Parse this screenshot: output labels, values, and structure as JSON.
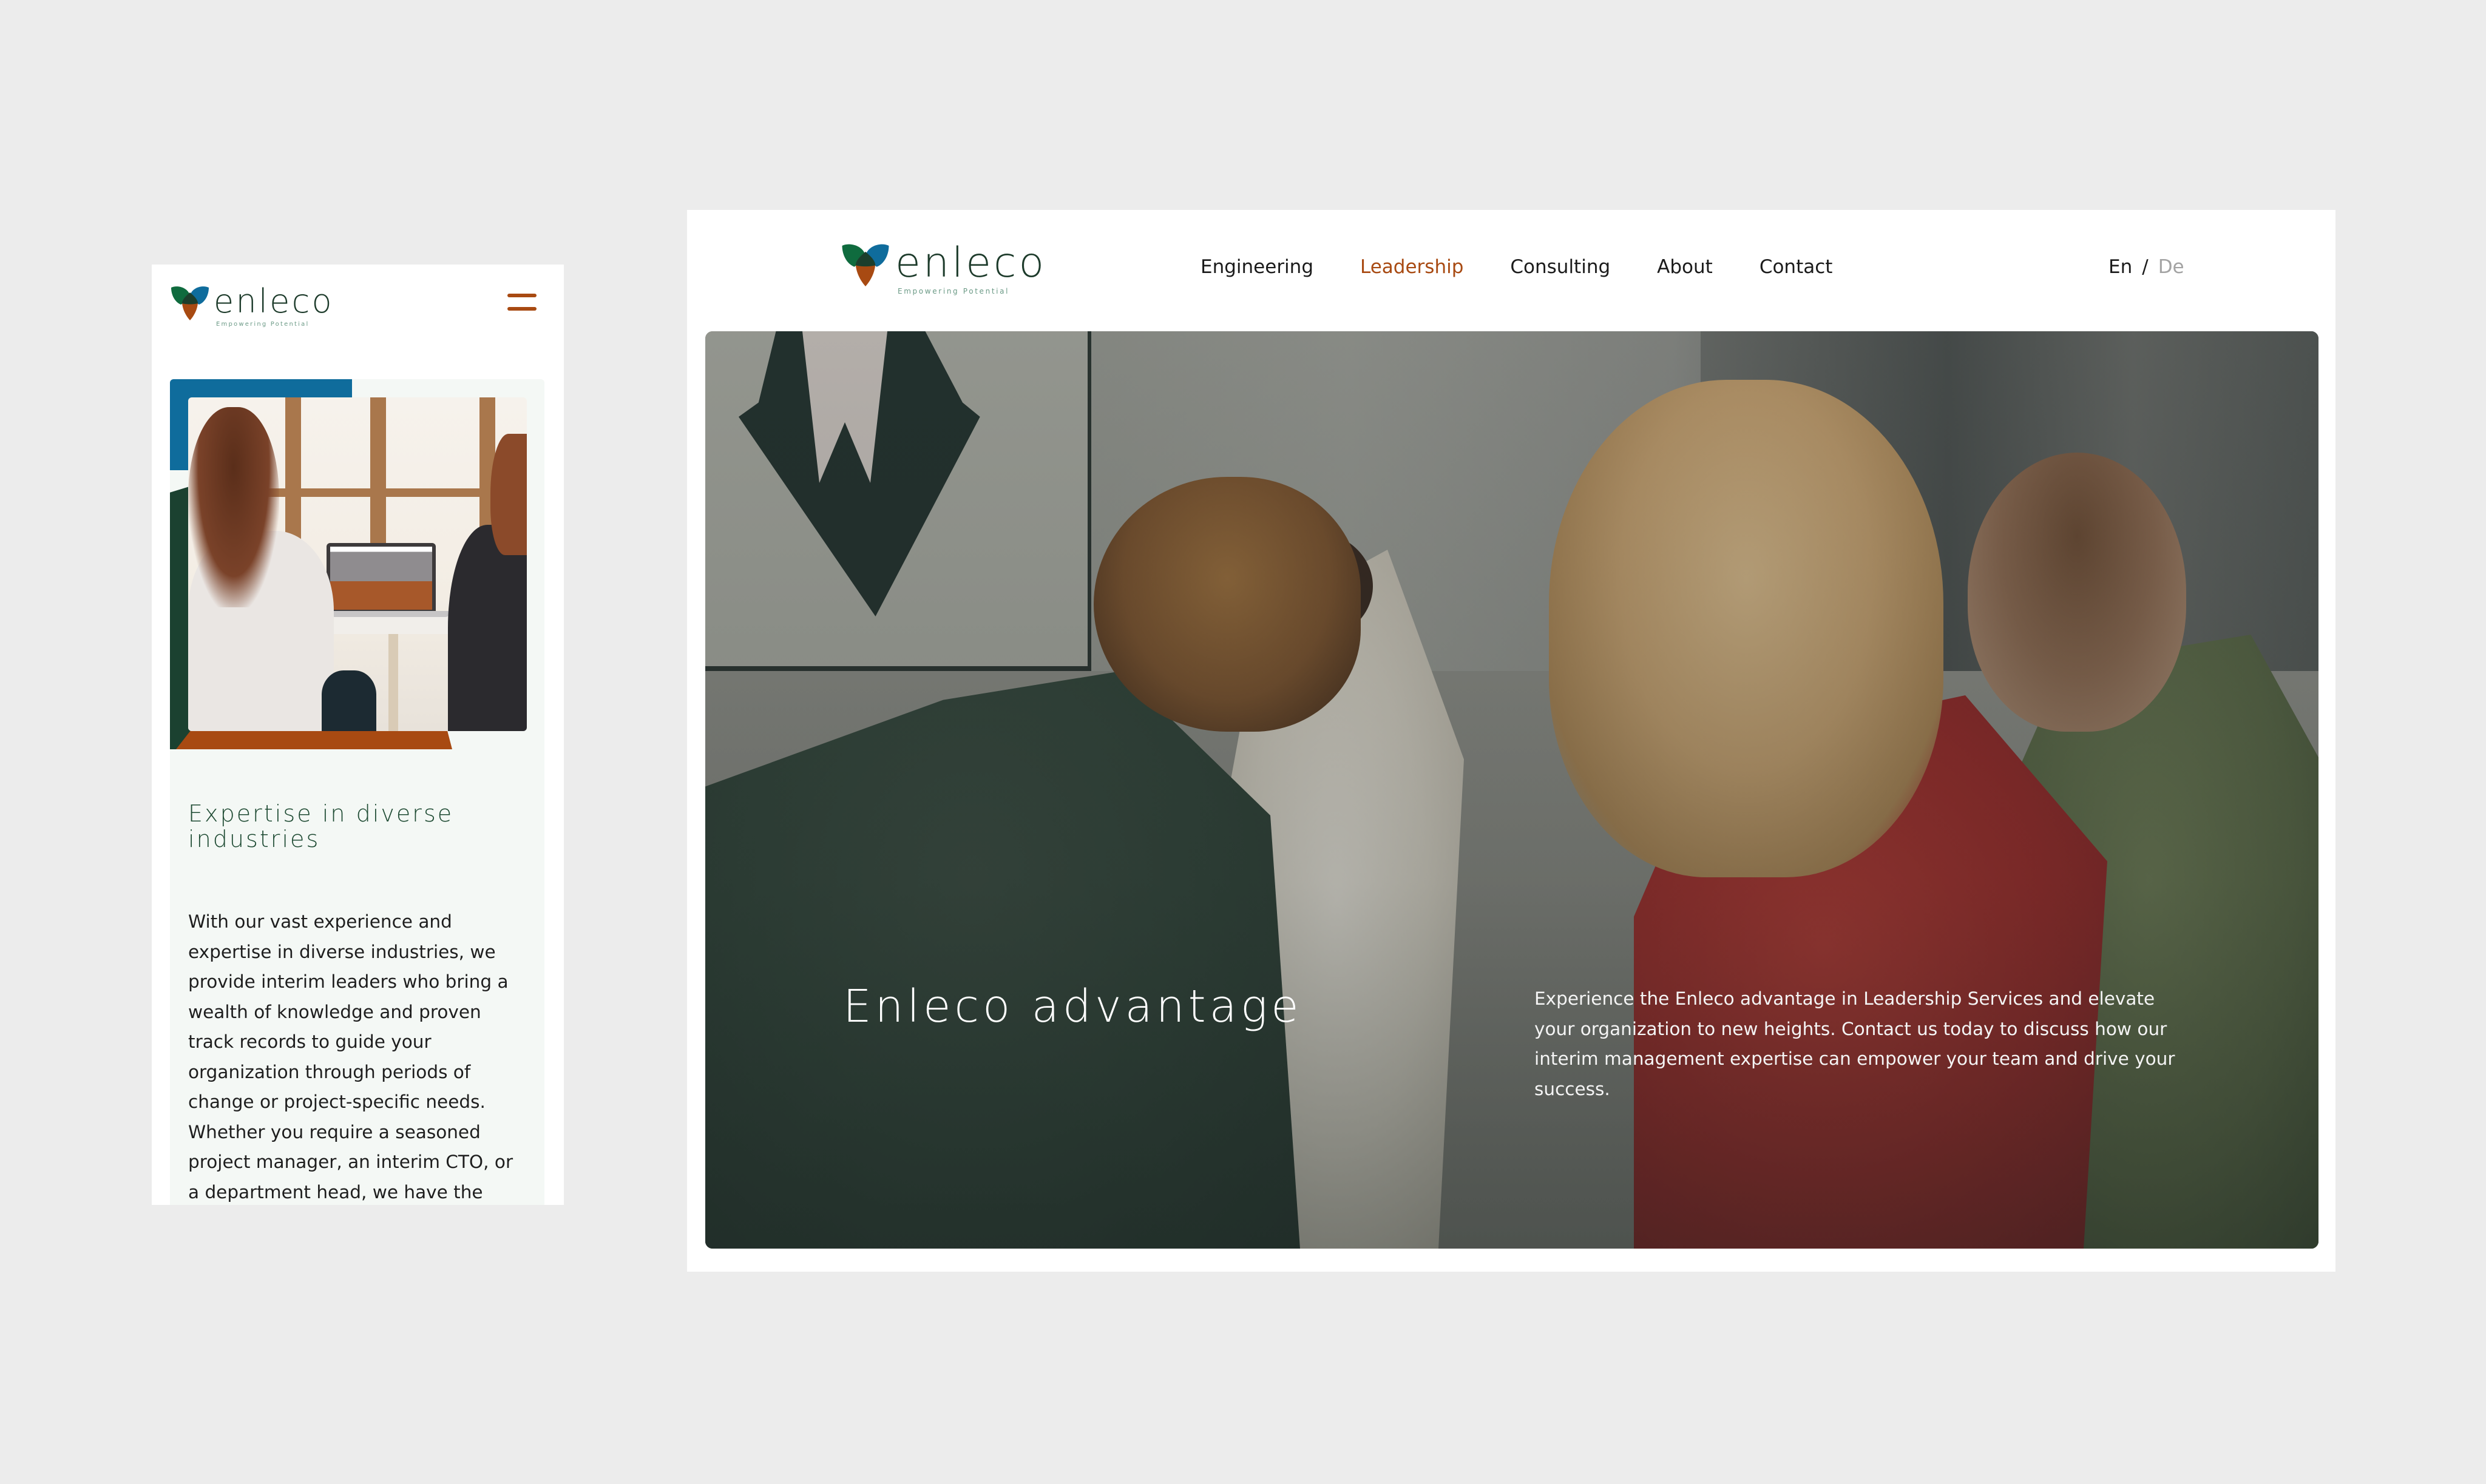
{
  "brand": {
    "name": "enleco",
    "tagline": "Empowering Potential",
    "colors": {
      "green": "#0f6b3e",
      "blue": "#0f6c9c",
      "orange": "#a84a12",
      "dark_green": "#1d3b2b",
      "card_bg": "#f4f8f5",
      "page_bg": "#ececec"
    }
  },
  "mobile": {
    "menu_icon": "hamburger-icon",
    "section": {
      "heading": "Expertise in diverse industries",
      "body": "With our vast experience and expertise in diverse industries, we provide interim leaders who bring a wealth of knowledge and proven track records to guide your organization through periods of change or project-specific needs. Whether you require a seasoned project manager, an interim CTO, or a department head, we have the",
      "image_alt": "Two women looking at a laptop showing the Enleco Leadership page"
    }
  },
  "desktop": {
    "nav": [
      {
        "label": "Engineering",
        "active": false
      },
      {
        "label": "Leadership",
        "active": true
      },
      {
        "label": "Consulting",
        "active": false
      },
      {
        "label": "About",
        "active": false
      },
      {
        "label": "Contact",
        "active": false
      }
    ],
    "language": {
      "en": "En",
      "separator": "/",
      "de": "De",
      "selected": "En"
    },
    "hero": {
      "title": "Enleco advantage",
      "text": "Experience the Enleco advantage in Leadership Services and elevate your organization to new heights. Contact us today to discuss how our interim management expertise can empower your team and drive your success.",
      "image_alt": "Team of four colleagues leaning over a table together"
    }
  }
}
